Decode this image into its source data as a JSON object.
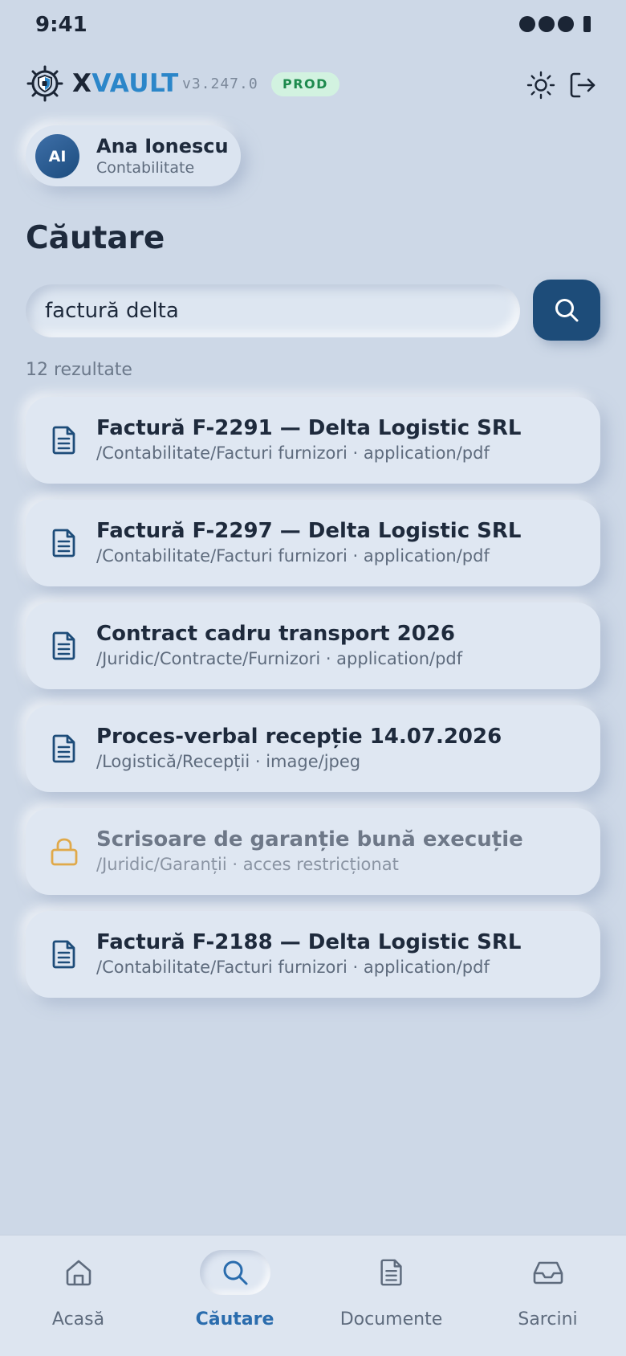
{
  "status_bar": {
    "time": "9:41"
  },
  "header": {
    "brand_x": "X",
    "brand_vault": "VAULT",
    "version": "v3.247.0",
    "env_badge": "PROD",
    "icons": {
      "logo": "vault-shield-logo-icon",
      "theme": "sun-icon",
      "logout": "logout-icon"
    }
  },
  "user": {
    "initials": "AI",
    "name": "Ana Ionescu",
    "department": "Contabilitate"
  },
  "page": {
    "title": "Căutare"
  },
  "search": {
    "value": "factură delta",
    "button_icon": "search-icon"
  },
  "results_count": "12 rezultate",
  "results": [
    {
      "title": "Factură F-2291 — Delta Logistic SRL",
      "meta": "/Contabilitate/Facturi furnizori · application/pdf",
      "icon": "document-icon",
      "locked": false
    },
    {
      "title": "Factură F-2297 — Delta Logistic SRL",
      "meta": "/Contabilitate/Facturi furnizori · application/pdf",
      "icon": "document-icon",
      "locked": false
    },
    {
      "title": "Contract cadru transport 2026",
      "meta": "/Juridic/Contracte/Furnizori · application/pdf",
      "icon": "document-icon",
      "locked": false
    },
    {
      "title": "Proces-verbal recepție 14.07.2026",
      "meta": "/Logistică/Recepții · image/jpeg",
      "icon": "document-icon",
      "locked": false
    },
    {
      "title": "Scrisoare de garanție bună execuție",
      "meta": "/Juridic/Garanții · acces restricționat",
      "icon": "lock-icon",
      "locked": true
    },
    {
      "title": "Factură F-2188 — Delta Logistic SRL",
      "meta": "/Contabilitate/Facturi furnizori · application/pdf",
      "icon": "document-icon",
      "locked": false
    }
  ],
  "tabbar": [
    {
      "label": "Acasă",
      "icon": "home-icon",
      "active": false
    },
    {
      "label": "Căutare",
      "icon": "search-icon",
      "active": true
    },
    {
      "label": "Documente",
      "icon": "document-icon",
      "active": false
    },
    {
      "label": "Sarcini",
      "icon": "inbox-icon",
      "active": false
    }
  ],
  "colors": {
    "accent": "#1d4c79",
    "active_tab": "#2a6cad",
    "prod_badge_bg": "#d2f2e0",
    "prod_badge_text": "#1d8a4d",
    "lock": "#e0a94a",
    "background": "#cdd8e7"
  }
}
